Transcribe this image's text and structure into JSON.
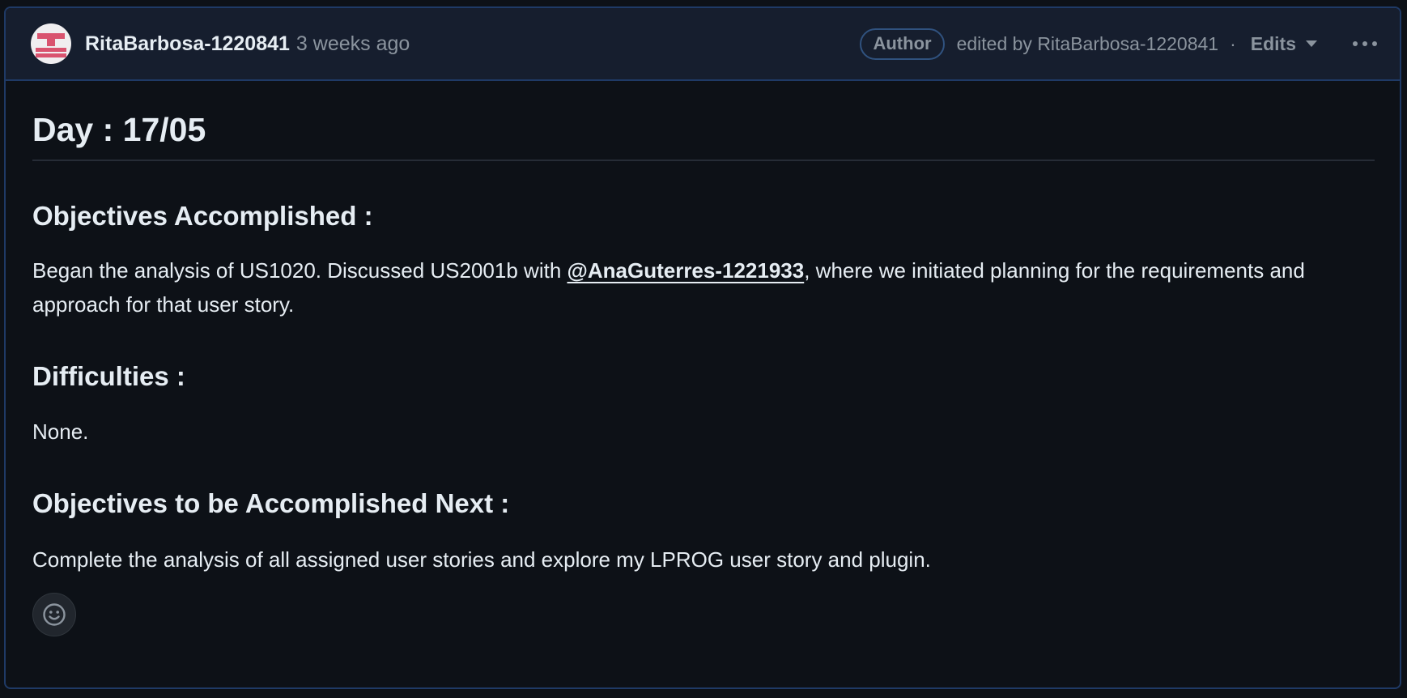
{
  "header": {
    "author": "RitaBarbosa-1220841",
    "timestamp": "3 weeks ago",
    "badge": "Author",
    "edited_by": "edited by RitaBarbosa-1220841",
    "separator": "·",
    "edits_label": "Edits"
  },
  "content": {
    "title": "Day : 17/05",
    "sections": [
      {
        "heading": "Objectives Accomplished :",
        "text_before": "Began the analysis of US1020. Discussed US2001b with ",
        "mention": "@AnaGuterres-1221933",
        "text_after": ", where we initiated planning for the requirements and approach for that user story."
      },
      {
        "heading": "Difficulties :",
        "text": "None."
      },
      {
        "heading": "Objectives to be Accomplished Next :",
        "text": "Complete the analysis of all assigned user stories and explore my LPROG user story and plugin."
      }
    ]
  },
  "colors": {
    "background": "#0d1117",
    "header_bg": "#161e2e",
    "border": "#1f3a66",
    "muted_text": "#8b949e",
    "avatar_red": "#d9536f"
  },
  "icons": {
    "avatar": "identicon-avatar",
    "menu": "kebab-horizontal-icon",
    "dropdown": "triangle-down-icon",
    "reaction": "smiley-icon"
  }
}
